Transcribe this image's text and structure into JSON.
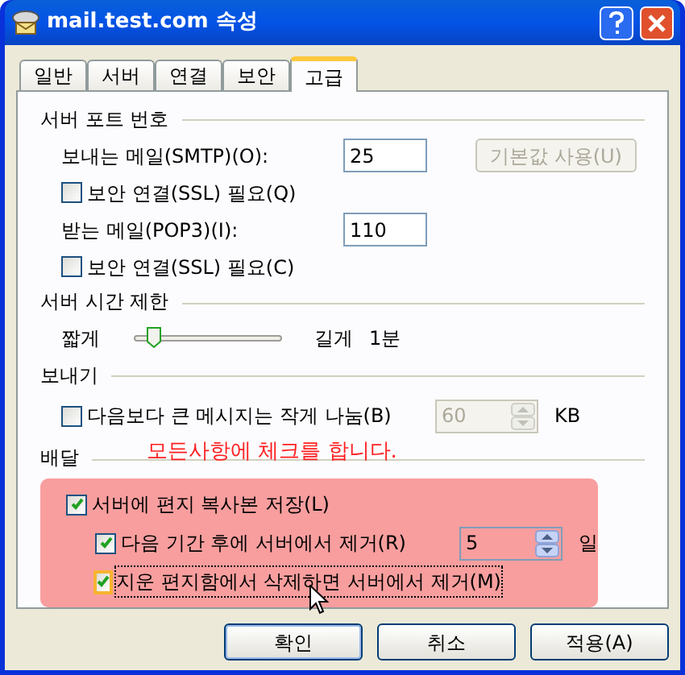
{
  "window": {
    "title": "mail.test.com 속성"
  },
  "tabs": [
    {
      "label": "일반",
      "selected": false
    },
    {
      "label": "서버",
      "selected": false
    },
    {
      "label": "연결",
      "selected": false
    },
    {
      "label": "보안",
      "selected": false
    },
    {
      "label": "고급",
      "selected": true
    }
  ],
  "server_ports": {
    "heading": "서버 포트 번호",
    "smtp_label": "보내는 메일(SMTP)(O):",
    "smtp_value": "25",
    "default_button": {
      "label": "기본값 사용(U)",
      "disabled": true
    },
    "smtp_ssl": {
      "label": "보안 연결(SSL) 필요(Q)",
      "checked": false
    },
    "pop3_label": "받는 메일(POP3)(I):",
    "pop3_value": "110",
    "pop3_ssl": {
      "label": "보안 연결(SSL) 필요(C)",
      "checked": false
    }
  },
  "server_timeout": {
    "heading": "서버 시간 제한",
    "short_label": "짧게",
    "level": 0.13,
    "long_label": "길게",
    "reading": "1분"
  },
  "sending": {
    "heading": "보내기",
    "split": {
      "label": "다음보다 큰 메시지는 작게 나눔(B)",
      "checked": false
    },
    "size_value": "60",
    "size_disabled": true,
    "size_unit": "KB"
  },
  "delivery": {
    "heading": "배달",
    "annotation": "모든사항에 체크를 합니다.",
    "items": [
      {
        "label": "서버에 편지 복사본 저장(L)",
        "checked": true,
        "children": [
          {
            "label": "다음 기간 후에 서버에서 제거(R)",
            "checked": true,
            "value": "5",
            "unit": "일"
          },
          {
            "label": "지운 편지함에서 삭제하면 서버에서 제거(M)",
            "checked": true,
            "focused": true
          }
        ]
      }
    ]
  },
  "buttons": [
    "확인",
    "취소",
    "적용(A)"
  ]
}
